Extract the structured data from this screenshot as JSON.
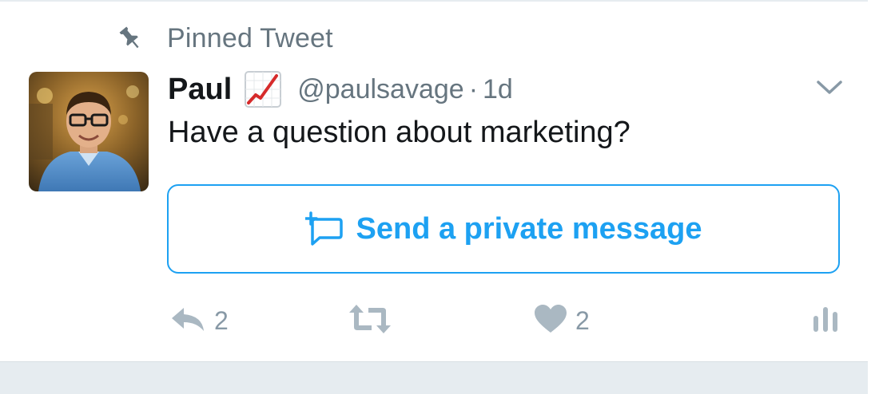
{
  "pinned": {
    "label": "Pinned Tweet",
    "icon": "pin-icon"
  },
  "tweet": {
    "display_name": "Paul",
    "name_emoji": "chart-increasing-emoji",
    "handle": "@paulsavage",
    "separator": "·",
    "timestamp": "1d",
    "text": "Have a question about marketing?",
    "avatar": "profile-photo"
  },
  "dm_button": {
    "label": "Send a private message",
    "icon": "direct-message-icon"
  },
  "actions": {
    "reply_count": "2",
    "retweet_count": "",
    "like_count": "2"
  },
  "colors": {
    "accent": "#1da1f2",
    "muted": "#66757f",
    "action_gray": "#aab8c2",
    "text": "#14171a",
    "divider": "#e6ecf0"
  }
}
